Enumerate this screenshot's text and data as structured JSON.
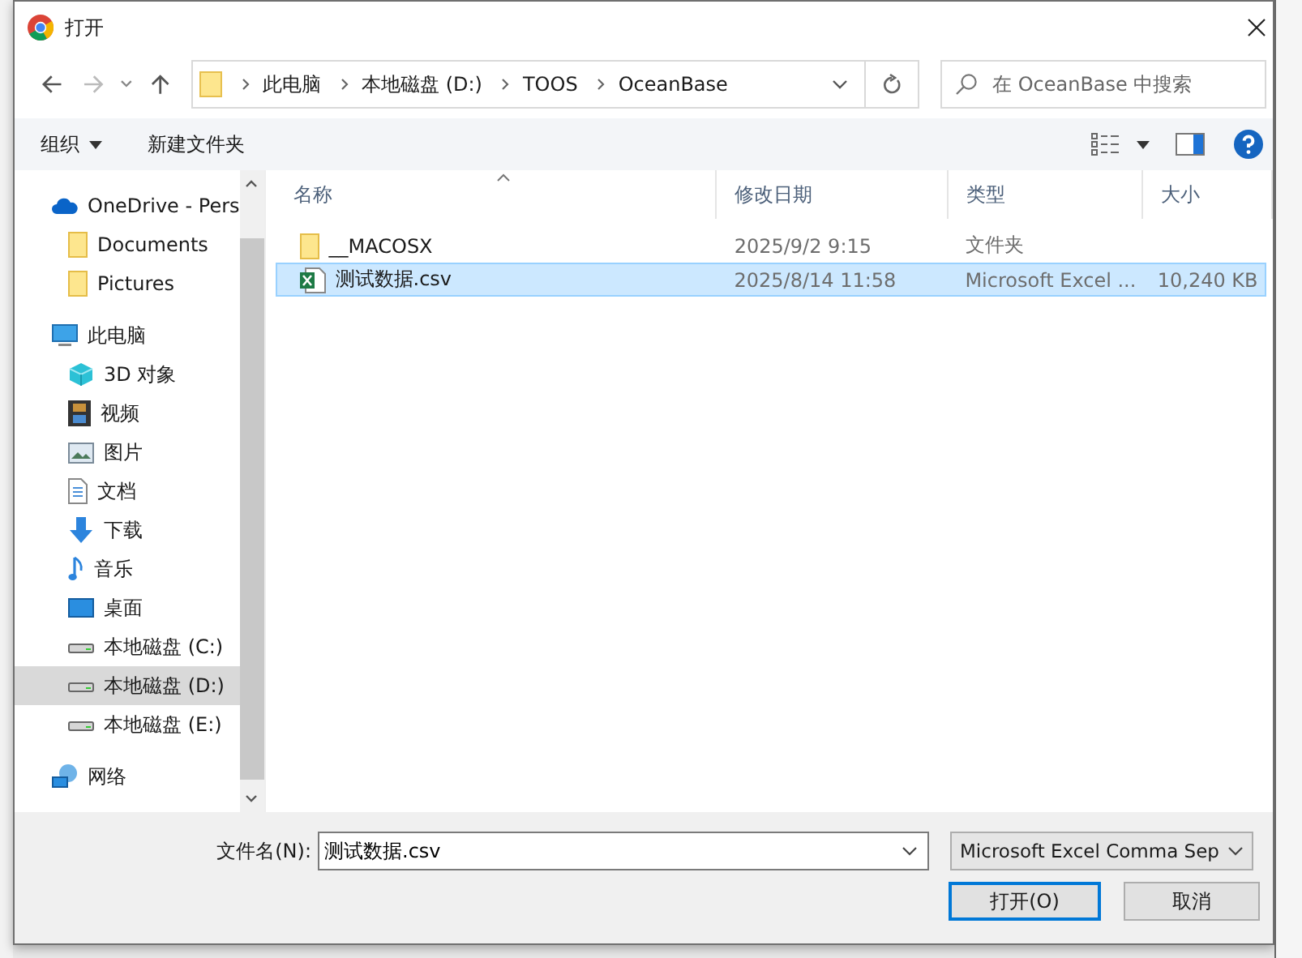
{
  "window": {
    "title": "打开"
  },
  "nav": {
    "path": [
      "此电脑",
      "本地磁盘 (D:)",
      "TOOS",
      "OceanBase"
    ],
    "search": {
      "placeholder": "在 OceanBase 中搜索"
    }
  },
  "toolbar": {
    "organize": "组织",
    "new_folder": "新建文件夹"
  },
  "sidebar": {
    "items": [
      {
        "label": "OneDrive - Pers",
        "kind": "onedrive",
        "selected": false,
        "children": [
          {
            "label": "Documents",
            "kind": "folder",
            "selected": false
          },
          {
            "label": "Pictures",
            "kind": "folder",
            "selected": false
          }
        ]
      },
      {
        "label": "此电脑",
        "kind": "pc",
        "selected": false,
        "children": [
          {
            "label": "3D 对象",
            "kind": "cube",
            "selected": false
          },
          {
            "label": "视频",
            "kind": "video",
            "selected": false
          },
          {
            "label": "图片",
            "kind": "picture",
            "selected": false
          },
          {
            "label": "文档",
            "kind": "document",
            "selected": false
          },
          {
            "label": "下载",
            "kind": "download",
            "selected": false
          },
          {
            "label": "音乐",
            "kind": "music",
            "selected": false
          },
          {
            "label": "桌面",
            "kind": "desktop",
            "selected": false
          },
          {
            "label": "本地磁盘 (C:)",
            "kind": "drive",
            "selected": false
          },
          {
            "label": "本地磁盘 (D:)",
            "kind": "drive",
            "selected": true
          },
          {
            "label": "本地磁盘 (E:)",
            "kind": "drive",
            "selected": false
          }
        ]
      },
      {
        "label": "网络",
        "kind": "network",
        "selected": false
      }
    ]
  },
  "file_list": {
    "columns": [
      "名称",
      "修改日期",
      "类型",
      "大小"
    ],
    "rows": [
      {
        "name": "__MACOSX",
        "kind": "folder",
        "date": "2025/9/2 9:15",
        "type": "文件夹",
        "selected": false
      },
      {
        "name": "测试数据.csv",
        "kind": "csv",
        "date": "2025/8/14 11:58",
        "type": "Microsoft Excel ...",
        "size": "10,240 KB",
        "selected": true
      }
    ]
  },
  "footer": {
    "filename_label": "文件名(N):",
    "filename": "测试数据.csv",
    "filter": "Microsoft Excel Comma Sep",
    "buttons": [
      "打开(O)",
      "取消"
    ]
  }
}
